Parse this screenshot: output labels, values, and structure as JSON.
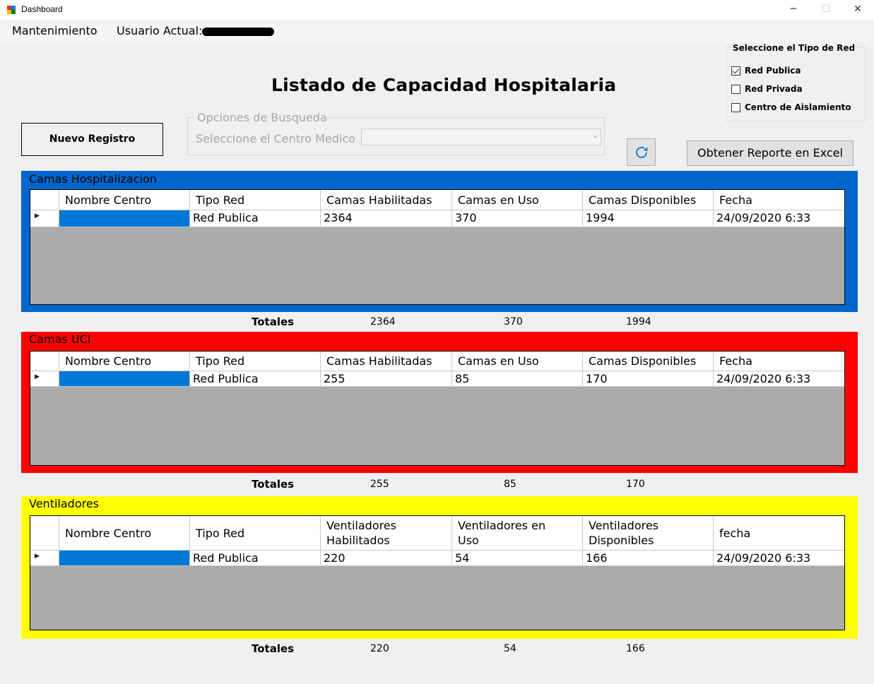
{
  "window": {
    "title": "Dashboard",
    "minimize": "─",
    "maximize": "☐",
    "close": "✕"
  },
  "menu": {
    "mantenimiento": "Mantenimiento",
    "usuario_label": "Usuario Actual:"
  },
  "page_title": "Listado de Capacidad Hospitalaria",
  "buttons": {
    "nuevo_registro": "Nuevo Registro",
    "excel": "Obtener Reporte en Excel",
    "refresh_icon": "refresh-icon"
  },
  "search": {
    "legend": "Opciones de Busqueda",
    "label": "Seleccione el Centro Medico",
    "selected": ""
  },
  "tipo_red": {
    "legend": "Seleccione el Tipo de Red",
    "options": [
      {
        "label": "Red Publica",
        "checked": true
      },
      {
        "label": "Red Privada",
        "checked": false
      },
      {
        "label": "Centro de Aislamiento",
        "checked": false
      }
    ]
  },
  "colors": {
    "hospitalizacion": "#0066cc",
    "uci": "#ff0000",
    "ventiladores": "#ffff00",
    "selection": "#0078d7",
    "grid_bg": "#ababab"
  },
  "sections": [
    {
      "title": "Camas Hospitalizacion",
      "headers": [
        "Nombre Centro",
        "Tipo Red",
        "Camas Habilitadas",
        "Camas en Uso",
        "Camas Disponibles",
        "Fecha"
      ],
      "row": [
        "",
        "Red Publica",
        "2364",
        "370",
        "1994",
        "24/09/2020 6:33"
      ],
      "totals_label": "Totales",
      "totals": [
        "2364",
        "370",
        "1994"
      ]
    },
    {
      "title": "Camas UCI",
      "headers": [
        "Nombre Centro",
        "Tipo Red",
        "Camas Habilitadas",
        "Camas en Uso",
        "Camas Disponibles",
        "Fecha"
      ],
      "row": [
        "",
        "Red Publica",
        "255",
        "85",
        "170",
        "24/09/2020 6:33"
      ],
      "totals_label": "Totales",
      "totals": [
        "255",
        "85",
        "170"
      ]
    },
    {
      "title": "Ventiladores",
      "headers": [
        "Nombre Centro",
        "Tipo Red",
        "Ventiladores Habilitados",
        "Ventiladores en Uso",
        "Ventiladores Disponibles",
        "fecha"
      ],
      "row": [
        "",
        "Red Publica",
        "220",
        "54",
        "166",
        "24/09/2020 6:33"
      ],
      "totals_label": "Totales",
      "totals": [
        "220",
        "54",
        "166"
      ]
    }
  ]
}
